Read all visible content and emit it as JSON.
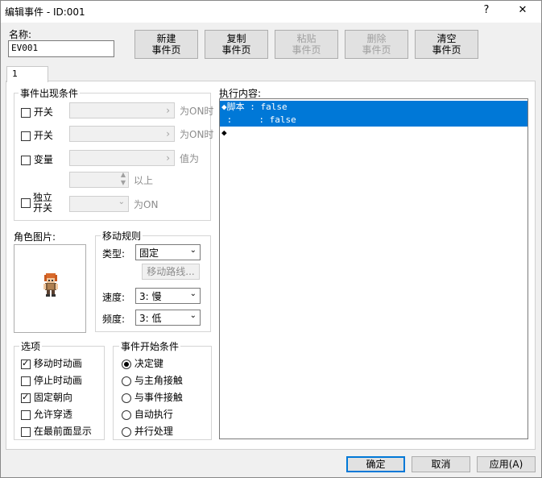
{
  "window": {
    "title": "编辑事件 - ID:001",
    "help_label": "?",
    "close_label": "✕"
  },
  "name_section": {
    "label": "名称:",
    "value": "EV001"
  },
  "toolbar": {
    "new_page": [
      "新建",
      "事件页"
    ],
    "copy_page": [
      "复制",
      "事件页"
    ],
    "paste_page": [
      "粘贴",
      "事件页"
    ],
    "delete_page": [
      "删除",
      "事件页"
    ],
    "clear_page": [
      "清空",
      "事件页"
    ]
  },
  "tabs": [
    {
      "label": "1"
    }
  ],
  "conditions": {
    "title": "事件出现条件",
    "switch1": {
      "label": "开关",
      "suffix": "为ON时"
    },
    "switch2": {
      "label": "开关",
      "suffix": "为ON时"
    },
    "variable": {
      "label": "变量",
      "suffix": "值为",
      "suffix2": "以上"
    },
    "self_switch": {
      "label1": "独立",
      "label2": "开关",
      "suffix": "为ON"
    }
  },
  "graphic": {
    "title": "角色图片:"
  },
  "movement": {
    "title": "移动规则",
    "type_label": "类型:",
    "type_value": "固定",
    "route_button": "移动路线...",
    "speed_label": "速度:",
    "speed_value": "3: 慢",
    "freq_label": "频度:",
    "freq_value": "3: 低"
  },
  "options": {
    "title": "选项",
    "items": [
      {
        "label": "移动时动画",
        "checked": true
      },
      {
        "label": "停止时动画",
        "checked": false
      },
      {
        "label": "固定朝向",
        "checked": true
      },
      {
        "label": "允许穿透",
        "checked": false
      },
      {
        "label": "在最前面显示",
        "checked": false
      }
    ]
  },
  "trigger": {
    "title": "事件开始条件",
    "items": [
      {
        "label": "决定键",
        "selected": true
      },
      {
        "label": "与主角接触",
        "selected": false
      },
      {
        "label": "与事件接触",
        "selected": false
      },
      {
        "label": "自动执行",
        "selected": false
      },
      {
        "label": "并行处理",
        "selected": false
      }
    ]
  },
  "contents": {
    "title": "执行内容:",
    "lines": [
      {
        "text": "◆脚本 : false",
        "selected": true
      },
      {
        "text": " :     : false",
        "selected": true
      },
      {
        "text": "◆",
        "selected": false
      }
    ]
  },
  "footer": {
    "ok": "确定",
    "cancel": "取消",
    "apply": "应用(A)"
  },
  "colors": {
    "selection": "#0078d7",
    "window_bg": "#f0f0f0"
  }
}
